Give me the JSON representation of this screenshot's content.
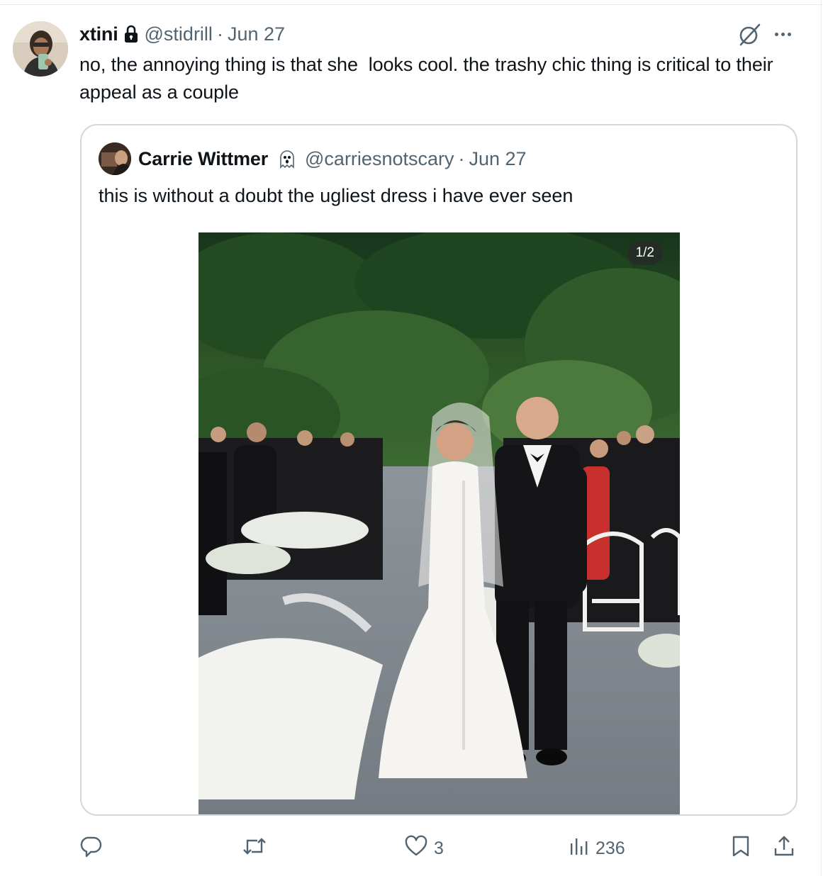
{
  "post": {
    "author_name": "xtini",
    "author_handle": "@stidrill",
    "separator": "·",
    "date": "Jun 27",
    "text": "no, the annoying thing is that she  looks cool. the trashy chic thing is critical to their appeal as a couple"
  },
  "quoted_post": {
    "author_name": "Carrie Wittmer",
    "author_handle": "@carriesnotscary",
    "separator": "·",
    "date": "Jun 27",
    "text": "this is without a doubt the ugliest dress i have ever seen",
    "media_counter": "1/2"
  },
  "actions": {
    "reply_count": "",
    "repost_count": "",
    "like_count": "3",
    "views_count": "236"
  },
  "icons": {
    "header": [
      "lock-icon",
      "grok-icon",
      "more-icon"
    ],
    "quoted_badge": "ghost-icon",
    "action_bar": [
      "reply-icon",
      "repost-icon",
      "like-icon",
      "views-icon",
      "bookmark-icon",
      "share-icon"
    ]
  },
  "colors": {
    "text_primary": "#0f1419",
    "text_secondary": "#536471",
    "border": "#cfd9de",
    "background": "#ffffff"
  }
}
